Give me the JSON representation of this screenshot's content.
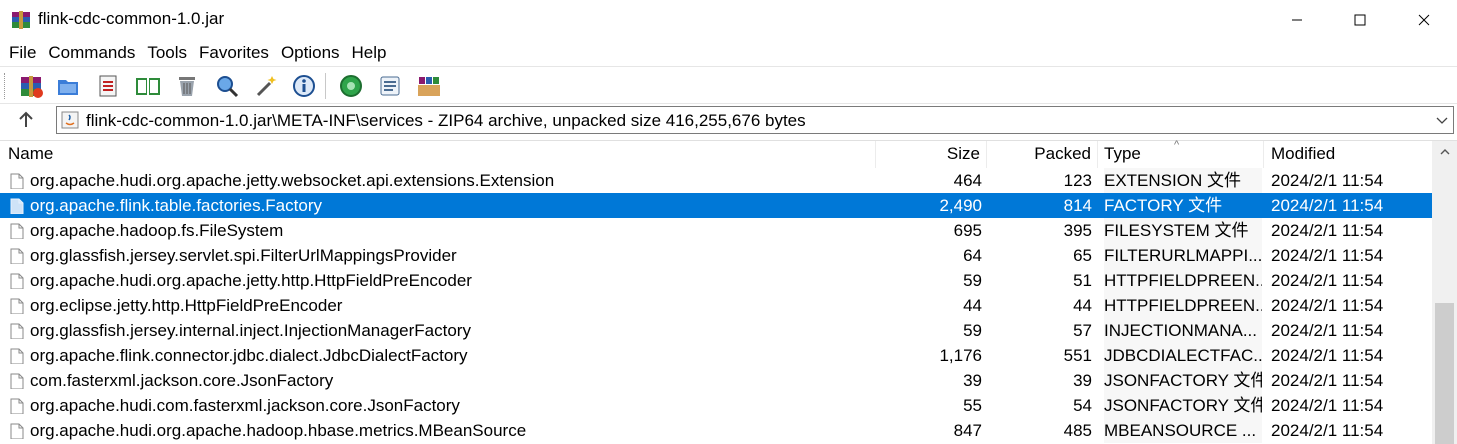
{
  "window": {
    "title": "flink-cdc-common-1.0.jar"
  },
  "menu": [
    "File",
    "Commands",
    "Tools",
    "Favorites",
    "Options",
    "Help"
  ],
  "toolbar": {
    "buttons": [
      "add-icon",
      "extract-icon",
      "test-icon",
      "view-icon",
      "delete-icon",
      "find-icon",
      "wizard-icon",
      "info-icon",
      "virus-scan-icon",
      "comment-icon",
      "sfx-icon"
    ]
  },
  "address": {
    "path": "flink-cdc-common-1.0.jar\\META-INF\\services - ZIP64 archive, unpacked size 416,255,676 bytes"
  },
  "columns": {
    "name": "Name",
    "size": "Size",
    "packed": "Packed",
    "type": "Type",
    "modified": "Modified",
    "sort_indicator": "^"
  },
  "files": [
    {
      "name": "org.apache.hudi.org.apache.jetty.websocket.api.extensions.Extension",
      "size": "464",
      "packed": "123",
      "type": "EXTENSION 文件",
      "modified": "2024/2/1 11:54",
      "selected": false
    },
    {
      "name": "org.apache.flink.table.factories.Factory",
      "size": "2,490",
      "packed": "814",
      "type": "FACTORY 文件",
      "modified": "2024/2/1 11:54",
      "selected": true
    },
    {
      "name": "org.apache.hadoop.fs.FileSystem",
      "size": "695",
      "packed": "395",
      "type": "FILESYSTEM 文件",
      "modified": "2024/2/1 11:54",
      "selected": false
    },
    {
      "name": "org.glassfish.jersey.servlet.spi.FilterUrlMappingsProvider",
      "size": "64",
      "packed": "65",
      "type": "FILTERURLMAPPI...",
      "modified": "2024/2/1 11:54",
      "selected": false
    },
    {
      "name": "org.apache.hudi.org.apache.jetty.http.HttpFieldPreEncoder",
      "size": "59",
      "packed": "51",
      "type": "HTTPFIELDPREEN...",
      "modified": "2024/2/1 11:54",
      "selected": false
    },
    {
      "name": "org.eclipse.jetty.http.HttpFieldPreEncoder",
      "size": "44",
      "packed": "44",
      "type": "HTTPFIELDPREEN...",
      "modified": "2024/2/1 11:54",
      "selected": false
    },
    {
      "name": "org.glassfish.jersey.internal.inject.InjectionManagerFactory",
      "size": "59",
      "packed": "57",
      "type": "INJECTIONMANA...",
      "modified": "2024/2/1 11:54",
      "selected": false
    },
    {
      "name": "org.apache.flink.connector.jdbc.dialect.JdbcDialectFactory",
      "size": "1,176",
      "packed": "551",
      "type": "JDBCDIALECTFAC...",
      "modified": "2024/2/1 11:54",
      "selected": false
    },
    {
      "name": "com.fasterxml.jackson.core.JsonFactory",
      "size": "39",
      "packed": "39",
      "type": "JSONFACTORY 文件",
      "modified": "2024/2/1 11:54",
      "selected": false
    },
    {
      "name": "org.apache.hudi.com.fasterxml.jackson.core.JsonFactory",
      "size": "55",
      "packed": "54",
      "type": "JSONFACTORY 文件",
      "modified": "2024/2/1 11:54",
      "selected": false
    },
    {
      "name": "org.apache.hudi.org.apache.hadoop.hbase.metrics.MBeanSource",
      "size": "847",
      "packed": "485",
      "type": "MBEANSOURCE ...",
      "modified": "2024/2/1 11:54",
      "selected": false
    }
  ],
  "colors": {
    "selection": "#0078d7",
    "scroll_thumb": "#cdcdcd"
  }
}
